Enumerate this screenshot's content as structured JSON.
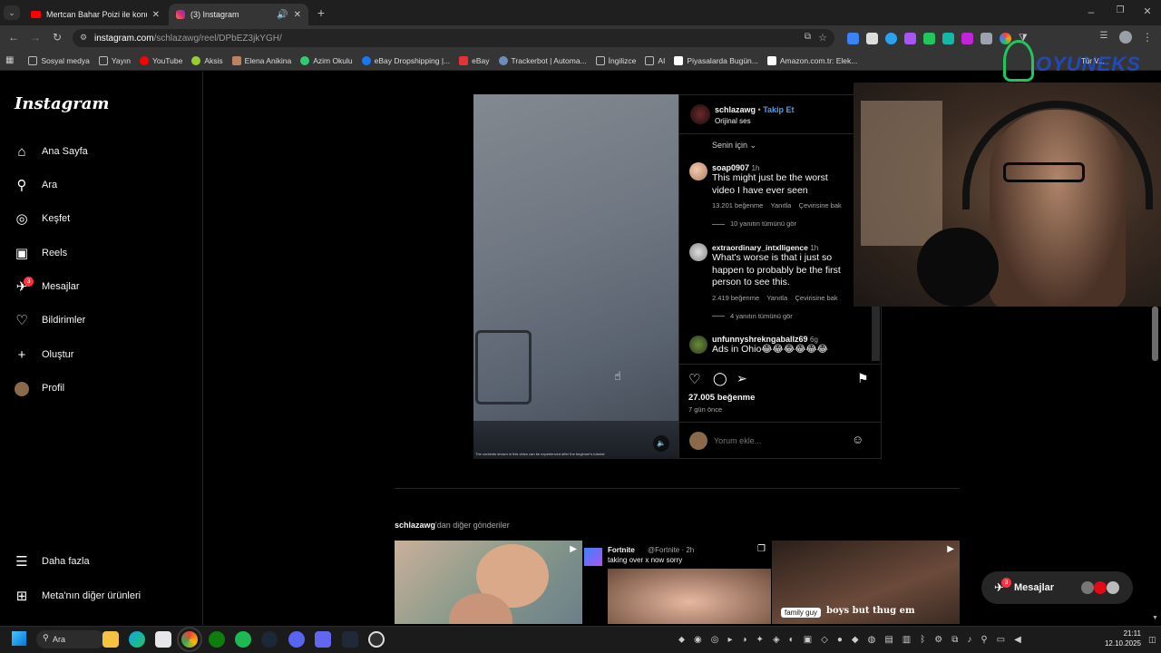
{
  "browser": {
    "tabs": [
      {
        "title": "Mertcan Bahar Poizi ile konuşu"
      },
      {
        "title": "(3) Instagram"
      }
    ],
    "url_host": "instagram.com",
    "url_path": "/schlazawg/reel/DPbEZ3jkYGH/",
    "bookmarks": [
      {
        "label": "Sosyal medya",
        "color": "#bbbbbb"
      },
      {
        "label": "Yayın",
        "color": "#bbbbbb"
      },
      {
        "label": "YouTube",
        "color": "#ff0000"
      },
      {
        "label": "Aksis",
        "color": "#9acd32"
      },
      {
        "label": "Elena Anikina",
        "color": "#c08060"
      },
      {
        "label": "Azim Okulu",
        "color": "#2ecc71"
      },
      {
        "label": "eBay Dropshipping |...",
        "color": "#1877f2"
      },
      {
        "label": "eBay",
        "color": "#e53238"
      },
      {
        "label": "Trackerbot | Automa...",
        "color": "#6c8ebf"
      },
      {
        "label": "İngilizce",
        "color": "#bbbbbb"
      },
      {
        "label": "AI",
        "color": "#bbbbbb"
      },
      {
        "label": "Piyasalarda Bugün...",
        "color": "#ffffff"
      },
      {
        "label": "Amazon.com.tr: Elek...",
        "color": "#ffffff"
      }
    ]
  },
  "instagram": {
    "logo": "Instagram",
    "nav": [
      {
        "label": "Ana Sayfa",
        "icon": "home-icon"
      },
      {
        "label": "Ara",
        "icon": "search-icon"
      },
      {
        "label": "Keşfet",
        "icon": "compass-icon"
      },
      {
        "label": "Reels",
        "icon": "reels-icon"
      },
      {
        "label": "Mesajlar",
        "icon": "messenger-icon",
        "badge": "3"
      },
      {
        "label": "Bildirimler",
        "icon": "heart-icon"
      },
      {
        "label": "Oluştur",
        "icon": "plus-icon"
      },
      {
        "label": "Profil",
        "icon": "avatar"
      }
    ],
    "more": "Daha fazla",
    "meta": "Meta'nın diğer ürünleri",
    "post": {
      "author": "schlazawg",
      "follow": "Takip Et",
      "audio": "Orijinal ses",
      "sort": "Senin için",
      "likes": "27.005 beğenme",
      "time": "7 gün önce",
      "comment_placeholder": "Yorum ekle...",
      "video_caption": "The contents shown in this video can be experienced after the beginner's tutorial"
    },
    "comments": [
      {
        "user": "soap0907",
        "time": "1h",
        "text": "This might just be the worst video I have ever seen",
        "likes": "13.201 beğenme",
        "reply": "Yanıtla",
        "translate": "Çevirisine bak",
        "view_replies": "10 yanıtın tümünü gör"
      },
      {
        "user": "extraordinary_intxlligence",
        "time": "1h",
        "text": "What's worse is that i just so happen to probably be the first person to see this.",
        "likes": "2.419 beğenme",
        "reply": "Yanıtla",
        "translate": "Çevirisine bak",
        "view_replies": "4 yanıtın tümünü gör"
      },
      {
        "user": "unfunnyshrekngaballz69",
        "time": "6g",
        "text": "Ads in Ohio😂😂😂😂😂😂"
      }
    ],
    "more_posts_user": "schlazawg",
    "more_posts_suffix": "'dan diğer gönderiler",
    "thumb2": {
      "name": "Fortnite",
      "handle": "@Fortnite · 2h",
      "text": "taking over x now sorry"
    },
    "thumb3_caption": "family guy",
    "thumb3_overlay": "boys but thug em",
    "messages_button": "Mesajlar",
    "messages_badge": "3"
  },
  "webcam": {
    "overlay": "OYUNEKS",
    "extra": "Tür  V..."
  },
  "taskbar": {
    "search": "Ara",
    "time": "21:11",
    "date": "12.10.2025"
  }
}
